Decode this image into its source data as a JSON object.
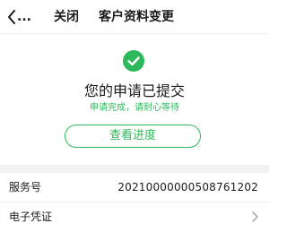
{
  "nav": {
    "back_dots": "...",
    "close_label": "关闭",
    "title": "客户资料变更"
  },
  "result": {
    "status_icon": "check-circle-icon",
    "title": "您的申请已提交",
    "subtitle": "申请完成，请耐心等待",
    "progress_button_label": "查看进度"
  },
  "details": {
    "rows": [
      {
        "label": "服务号",
        "value": "20210000000508761202"
      },
      {
        "label": "电子凭证",
        "value": ""
      }
    ]
  },
  "colors": {
    "accent": "#2eb85c",
    "divider": "#f2f2f2"
  }
}
